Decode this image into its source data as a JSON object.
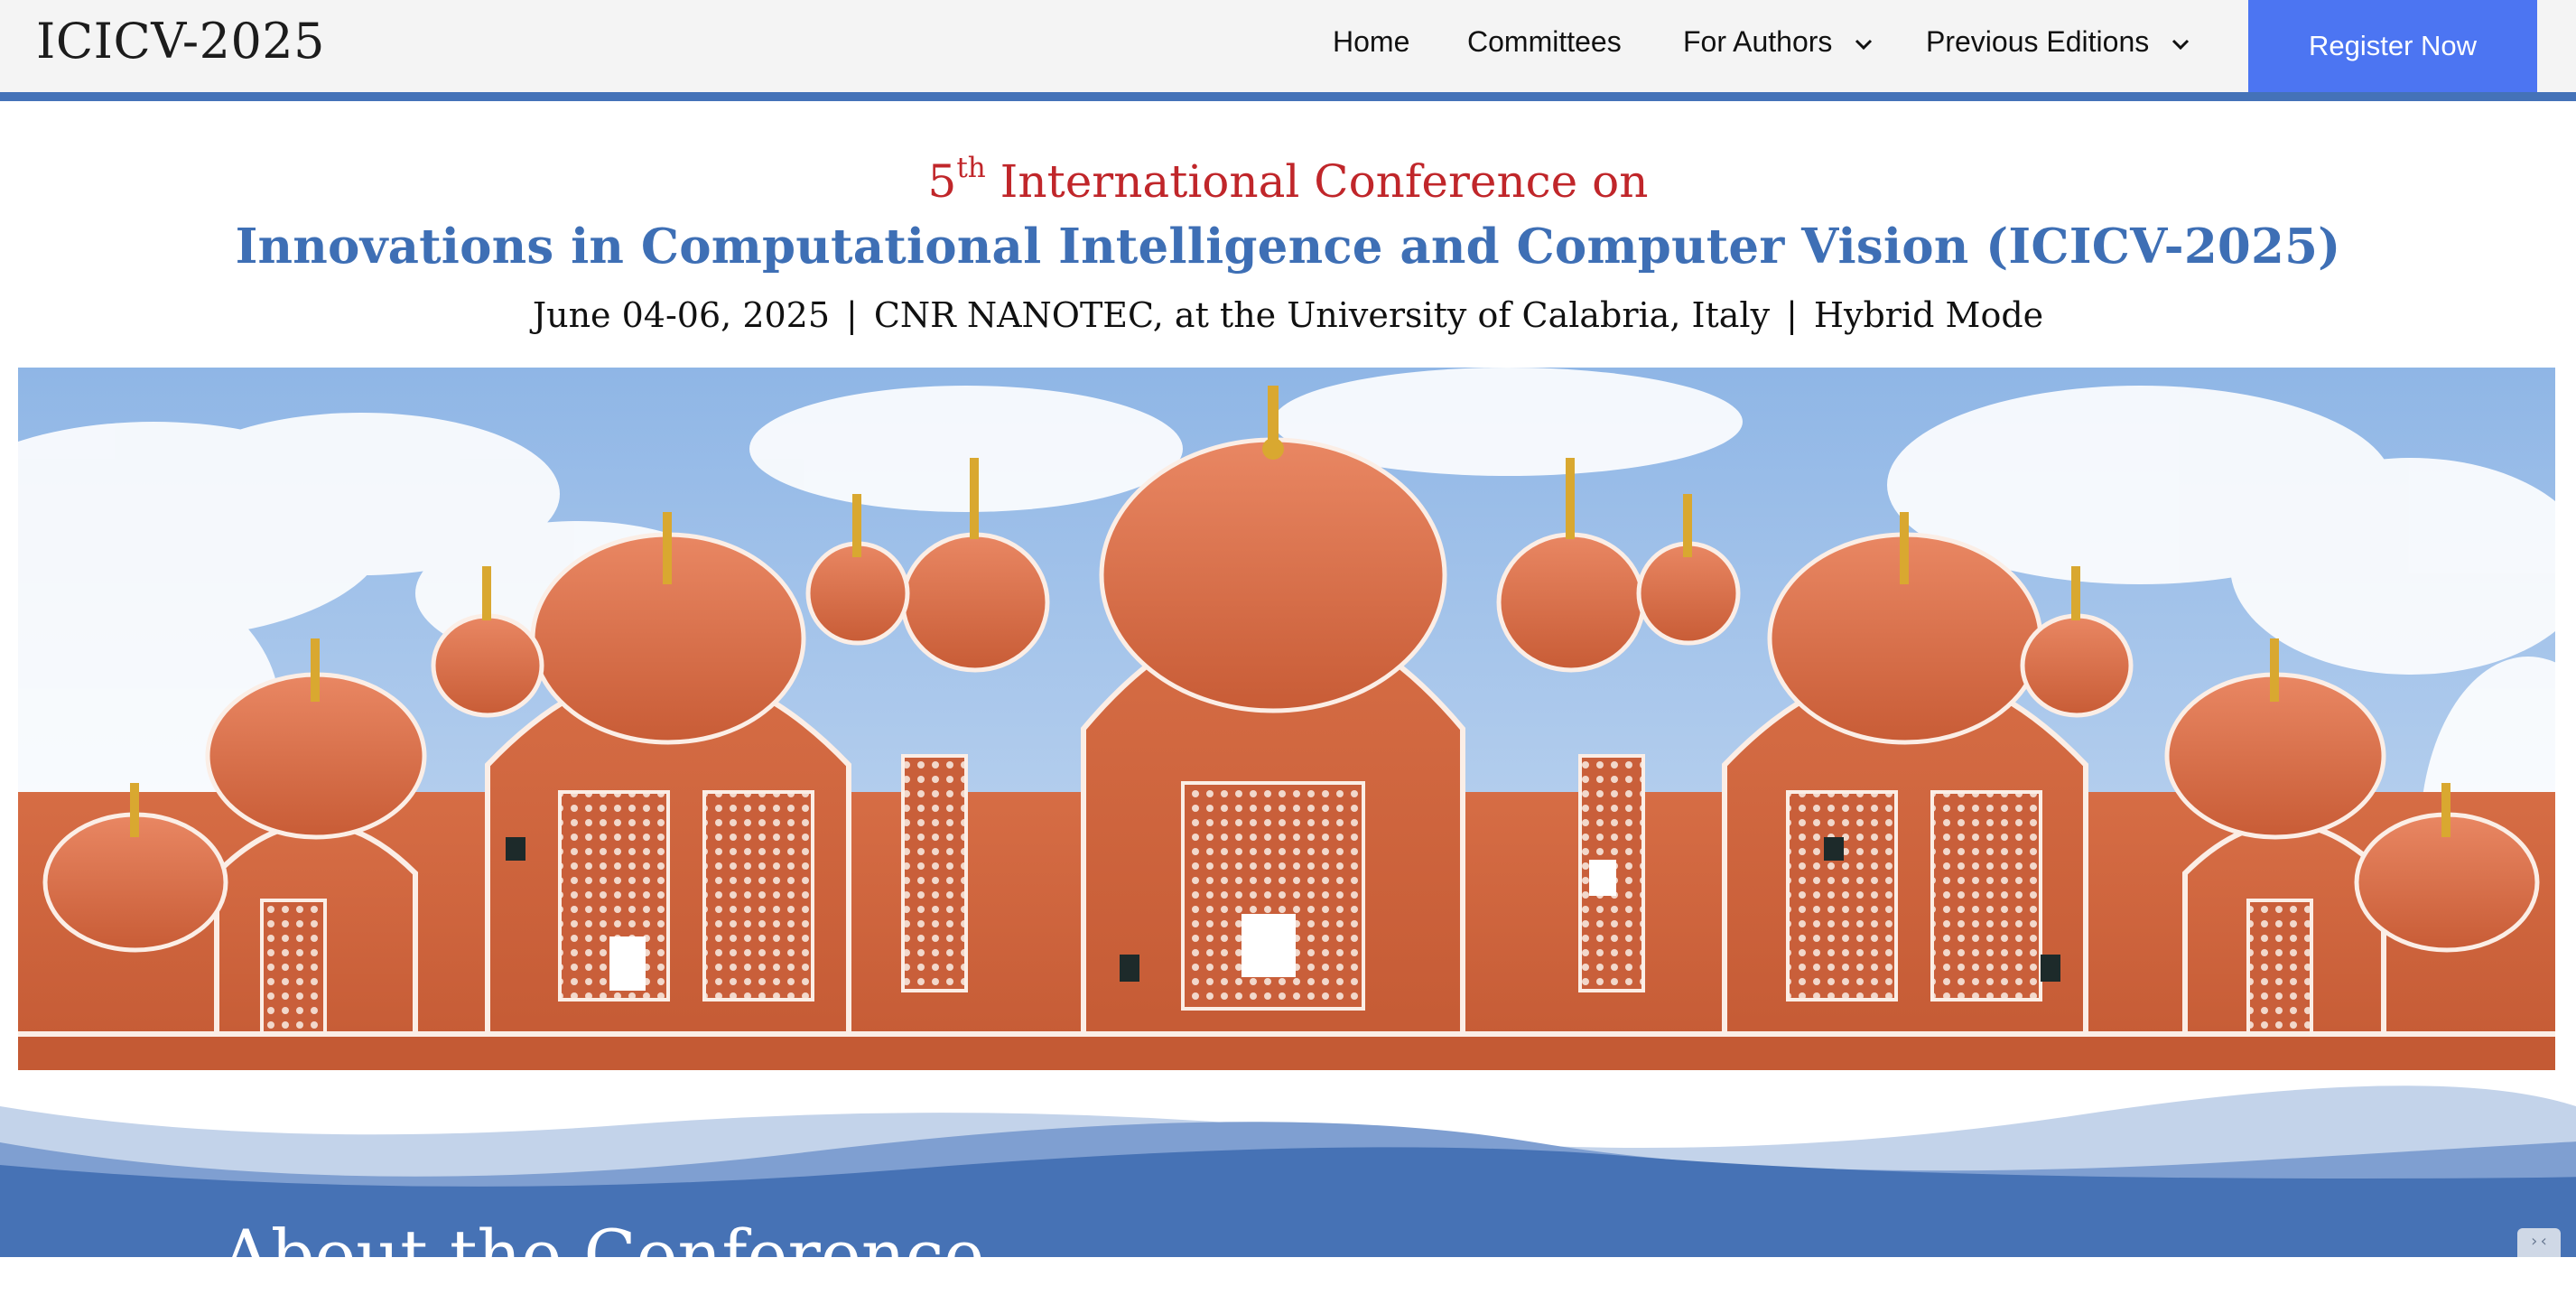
{
  "navbar": {
    "brand": "ICICV-2025",
    "items": [
      {
        "label": "Home"
      },
      {
        "label": "Committees"
      },
      {
        "label": "For Authors",
        "icon": "chevron-down-icon"
      },
      {
        "label": "Previous Editions",
        "icon": "chevron-down-icon"
      }
    ],
    "register_label": "Register Now"
  },
  "header": {
    "ordinal_number": "5",
    "ordinal_suffix": "th",
    "line1_rest": " International Conference on",
    "title": "Innovations in Computational Intelligence and Computer Vision (ICICV-2025)",
    "date": "June 04-06, 2025",
    "venue": "CNR NANOTEC, at the University of Calabria, Italy",
    "mode": "Hybrid Mode",
    "separator": "|"
  },
  "about": {
    "title": "About the Conference"
  },
  "colors": {
    "accent_blue": "#4472b8",
    "register_button": "#4c75f2",
    "heading_red": "#c0262a",
    "title_blue": "#3e6fb5",
    "palace_orange": "#d56a42"
  },
  "corner_widget": {
    "icon": "expand-icon",
    "glyph": "›‹"
  }
}
